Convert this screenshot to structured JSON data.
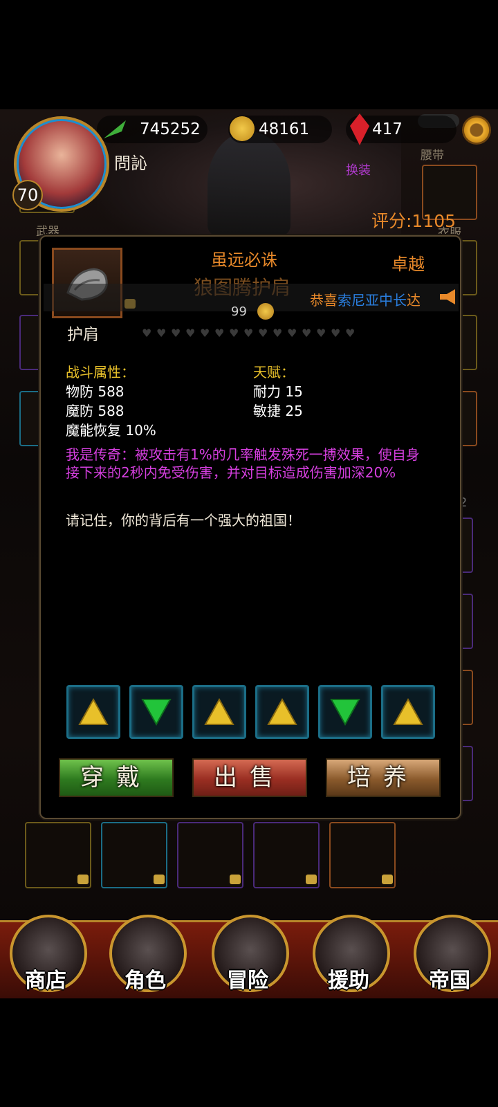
{
  "player": {
    "name": "問訫",
    "level": "70"
  },
  "resources": {
    "exp": "745252",
    "gold": "48161",
    "gems": "417"
  },
  "side_labels": {
    "waist": "腰带",
    "weapon": "武器",
    "clothes": "衣服",
    "change_outfit": "换装"
  },
  "score": "评分:1105",
  "item": {
    "title": "虽远必诛",
    "name": "狼图腾护肩",
    "rank": "卓越",
    "count": "99",
    "type": "护肩",
    "hearts": 15,
    "battle_header": "战斗属性：",
    "battle_stats": [
      "物防 588",
      "魔防 588",
      "魔能恢复 10%"
    ],
    "talent_header": "天赋：",
    "talent_stats": [
      "耐力 15",
      "敏捷 25"
    ],
    "legend_text": "我是传奇：被攻击有1%的几率触发殊死一搏效果，使自身接下来的2秒内免受伤害，并对目标造成伤害加深20%",
    "flavor_text": "请记住，你的背后有一个强大的祖国！"
  },
  "announcement": {
    "prefix": "恭喜",
    "name": "索尼亚",
    "suffix": "中长",
    "tail": "达"
  },
  "gems": [
    "gold-triangle",
    "green-triangle",
    "gold-triangle",
    "gold-triangle",
    "green-triangle",
    "gold-triangle"
  ],
  "colors": {
    "gold_gem": "#e8c02a",
    "green_gem": "#22c43a",
    "accent": "#e8892a",
    "legend": "#d63fe0"
  },
  "buttons": {
    "wear": "穿戴",
    "sell": "出售",
    "train": "培养"
  },
  "page_indicator": "2",
  "nav": [
    "商店",
    "角色",
    "冒险",
    "援助",
    "帝国"
  ]
}
